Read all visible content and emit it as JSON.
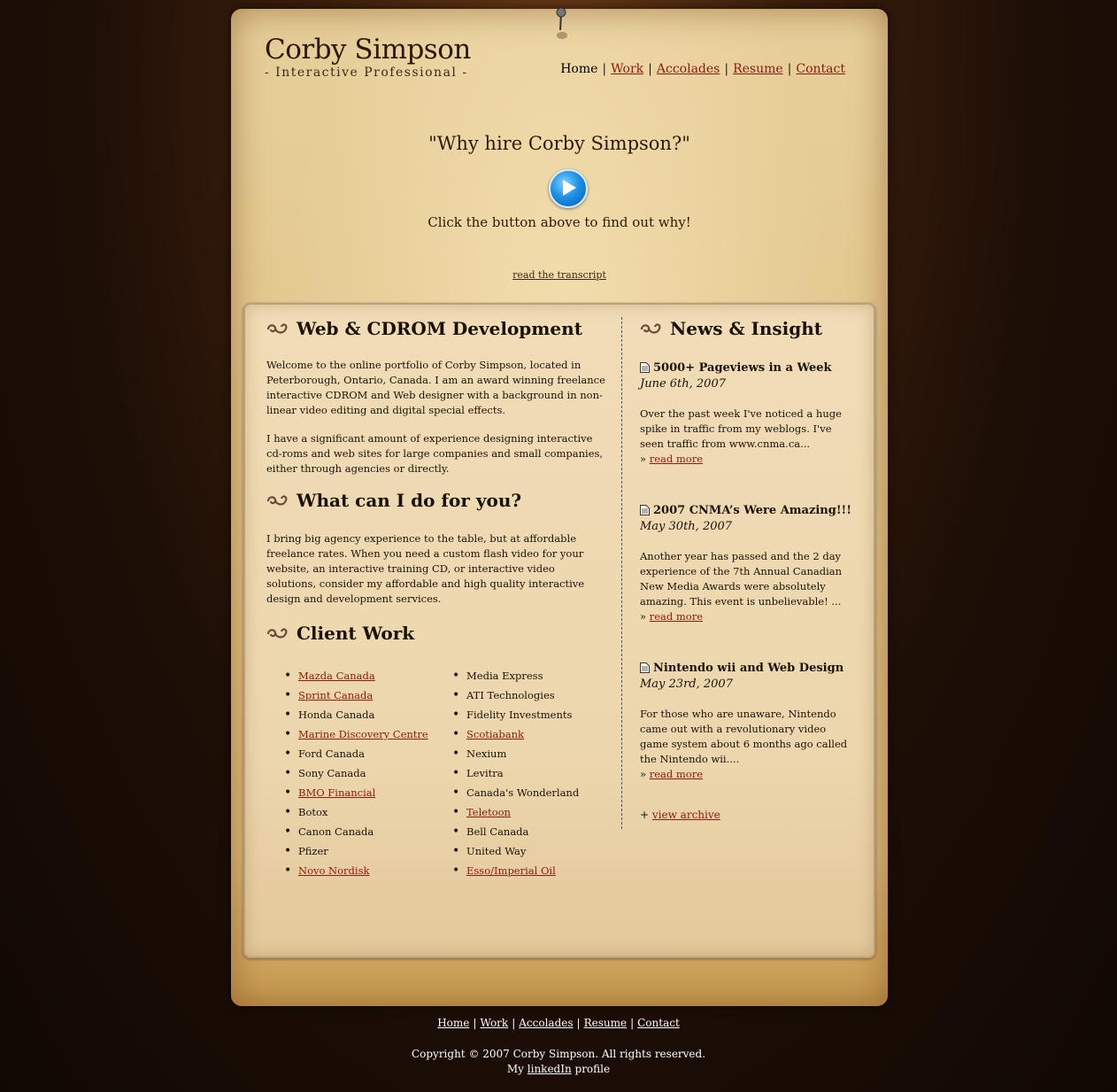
{
  "header": {
    "name": "Corby Simpson",
    "tagline": "- Interactive Professional -"
  },
  "nav": [
    {
      "label": "Home",
      "current": true
    },
    {
      "label": "Work",
      "current": false
    },
    {
      "label": "Accolades",
      "current": false
    },
    {
      "label": "Resume",
      "current": false
    },
    {
      "label": "Contact",
      "current": false
    }
  ],
  "hero": {
    "question": "\"Why hire Corby Simpson?\"",
    "subtitle": "Click the button above to find out why!",
    "transcript_link": "read the transcript",
    "play_icon": "play-icon"
  },
  "left": {
    "section1_title": "Web & CDROM Development",
    "section1_p1": "Welcome to the online portfolio of Corby Simpson, located in Peterborough, Ontario, Canada. I am an award winning freelance interactive CDROM and Web designer with a background in non-linear video editing and digital special effects.",
    "section1_p2": "I have a significant amount of experience designing interactive cd-roms and web sites for large companies and small companies, either through agencies or directly.",
    "section2_title": "What can I do for you?",
    "section2_p1": "I bring big agency experience to the table, but at affordable freelance rates. When you need a custom flash video for your website, an interactive training CD, or interactive video solutions, consider my affordable and high quality interactive design and development services.",
    "section3_title": "Client Work",
    "clients_col1": [
      {
        "name": "Mazda Canada",
        "link": true
      },
      {
        "name": "Sprint Canada",
        "link": true
      },
      {
        "name": "Honda Canada",
        "link": false
      },
      {
        "name": "Marine Discovery Centre",
        "link": true
      },
      {
        "name": "Ford Canada",
        "link": false
      },
      {
        "name": "Sony Canada",
        "link": false
      },
      {
        "name": "BMO Financial",
        "link": true
      },
      {
        "name": "Botox",
        "link": false
      },
      {
        "name": "Canon Canada",
        "link": false
      },
      {
        "name": "Pfizer",
        "link": false
      },
      {
        "name": "Novo Nordisk",
        "link": true
      }
    ],
    "clients_col2": [
      {
        "name": "Media Express",
        "link": false
      },
      {
        "name": "ATI Technologies",
        "link": false
      },
      {
        "name": "Fidelity Investments",
        "link": false
      },
      {
        "name": "Scotiabank",
        "link": true
      },
      {
        "name": "Nexium",
        "link": false
      },
      {
        "name": "Levitra",
        "link": false
      },
      {
        "name": "Canada's Wonderland",
        "link": false
      },
      {
        "name": "Teletoon",
        "link": true
      },
      {
        "name": "Bell Canada",
        "link": false
      },
      {
        "name": "United Way",
        "link": false
      },
      {
        "name": "Esso/Imperial Oil",
        "link": true
      }
    ]
  },
  "right": {
    "title": "News & Insight",
    "items": [
      {
        "title": "5000+ Pageviews in a Week",
        "date": "June 6th, 2007",
        "text": "Over the past week I've noticed a huge spike in traffic from my weblogs. I've seen traffic from www.cnma.ca...",
        "more_prefix": "» ",
        "more": "read more"
      },
      {
        "title": "2007 CNMA’s Were Amazing!!!",
        "date": "May 30th, 2007",
        "text": "Another year has passed and the 2 day experience of the 7th Annual Canadian New Media Awards were absolutely amazing. This event is unbelievable! ...",
        "more_prefix": "» ",
        "more": "read more"
      },
      {
        "title": "Nintendo wii and Web Design",
        "date": "May 23rd, 2007",
        "text": "For those who are unaware, Nintendo came out with a revolutionary video game system about 6 months ago called the Nintendo wii....",
        "more_prefix": "» ",
        "more": "read more"
      }
    ],
    "archive_prefix": "+ ",
    "archive": "view archive"
  },
  "footer": {
    "links": [
      "Home",
      "Work",
      "Accolades",
      "Resume",
      "Contact"
    ],
    "copyright": "Copyright © 2007 Corby Simpson. All rights reserved.",
    "profile_prefix": "My ",
    "profile_link": "linkedIn",
    "profile_suffix": " profile"
  },
  "colors": {
    "link": "#8b1a10",
    "background": "#1e0f06",
    "paper": "#e2c68c"
  }
}
